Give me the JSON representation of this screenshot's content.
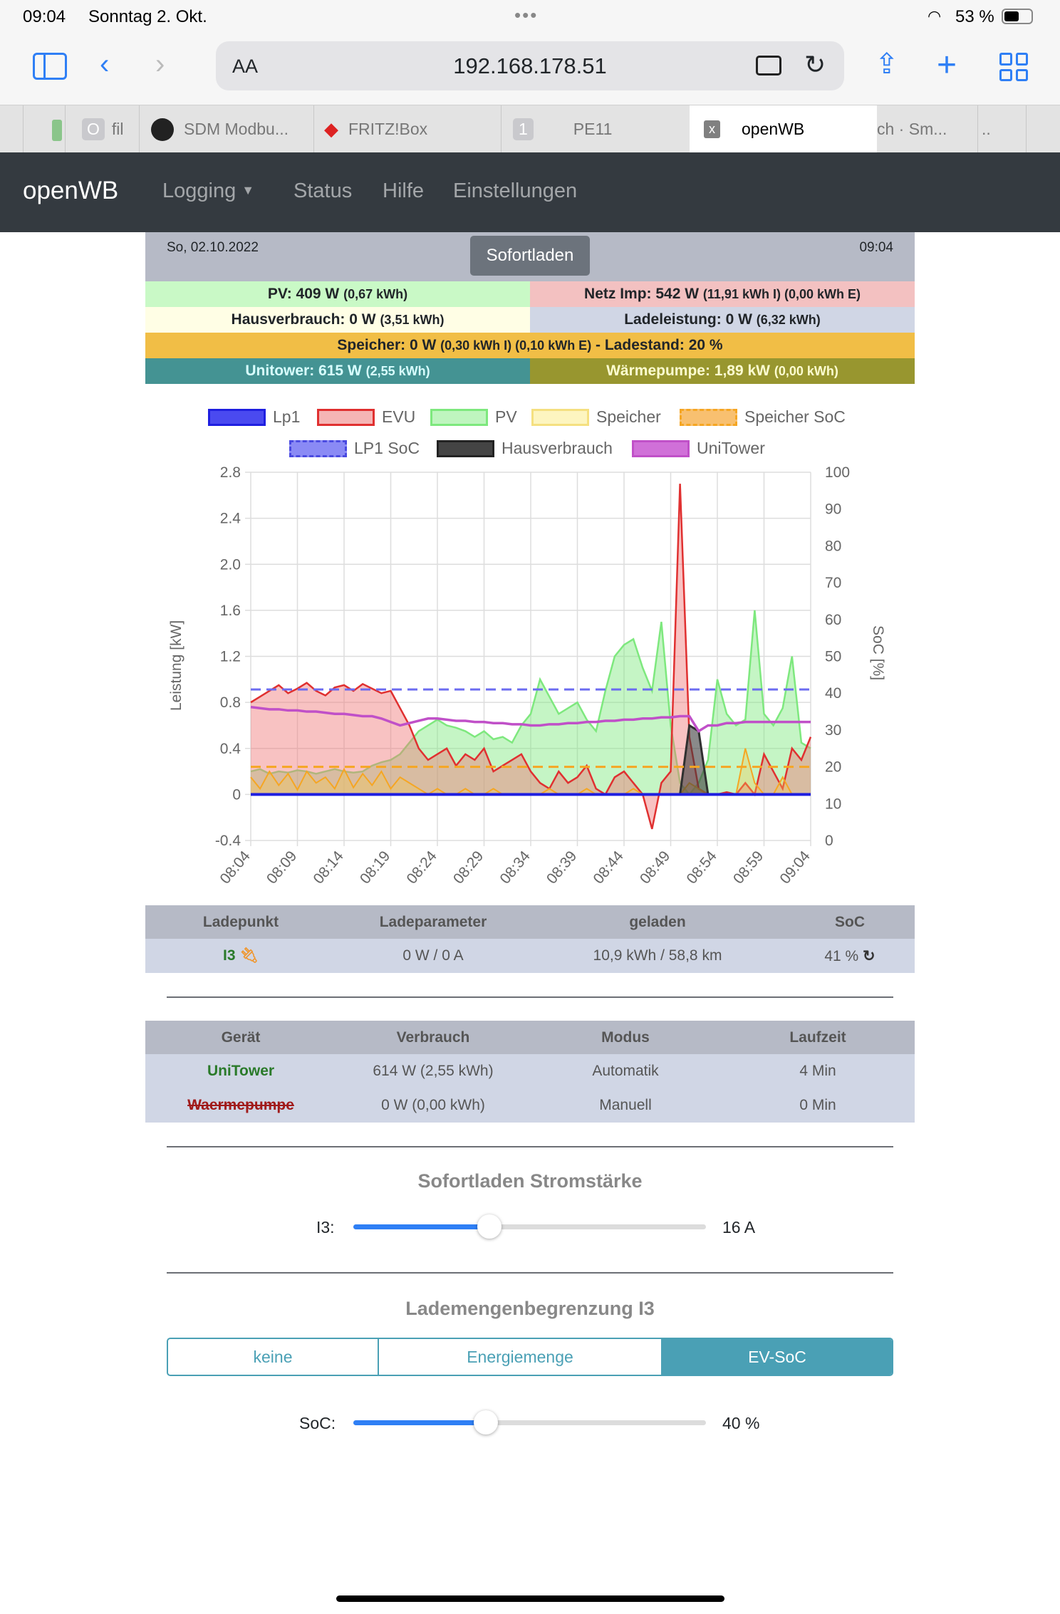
{
  "statusbar": {
    "time": "09:04",
    "date": "Sonntag 2. Okt.",
    "battery": "53 %"
  },
  "browser": {
    "aa_label": "AA",
    "url": "192.168.178.51",
    "tabs": [
      {
        "label": "fil"
      },
      {
        "label": "SDM Modbu..."
      },
      {
        "label": "FRITZ!Box"
      },
      {
        "label": "PE11",
        "badge": "1"
      },
      {
        "label": "openWB"
      },
      {
        "label": "ch · Sm..."
      },
      {
        "label": ".."
      }
    ]
  },
  "nav": {
    "brand": "openWB",
    "items": [
      "Logging",
      "Status",
      "Hilfe",
      "Einstellungen"
    ]
  },
  "header": {
    "date": "So, 02.10.2022",
    "mode_button": "Sofortladen",
    "time": "09:04"
  },
  "info": {
    "pv": {
      "main": "PV: 409 W",
      "sub": "(0,67 kWh)"
    },
    "netz": {
      "main": "Netz Imp: 542 W",
      "sub": "(11,91 kWh I) (0,00 kWh E)"
    },
    "haus": {
      "main": "Hausverbrauch: 0 W",
      "sub": "(3,51 kWh)"
    },
    "lade": {
      "main": "Ladeleistung: 0 W",
      "sub": "(6,32 kWh)"
    },
    "speicher": {
      "main1": "Speicher: 0 W",
      "sub": "(0,30 kWh I) (0,10 kWh E)",
      "main2": "- Ladestand: 20 %"
    },
    "unitower": {
      "main": "Unitower: 615 W",
      "sub": "(2,55 kWh)"
    },
    "waermepumpe": {
      "main": "Wärmepumpe: 1,89 kW",
      "sub": "(0,00 kWh)"
    }
  },
  "chart_data": {
    "type": "area",
    "xlabel": "",
    "ylabel": "Leistung [kW]",
    "y2label": "SoC [%]",
    "ylim": [
      -0.4,
      2.8
    ],
    "y2lim": [
      0,
      100
    ],
    "yticks": [
      "2.8",
      "2.4",
      "2.0",
      "1.6",
      "1.2",
      "0.8",
      "0.4",
      "0",
      "-0.4"
    ],
    "y2ticks": [
      "100",
      "90",
      "80",
      "70",
      "60",
      "50",
      "40",
      "30",
      "20",
      "10",
      "0"
    ],
    "xticks": [
      "08:04",
      "08:09",
      "08:14",
      "08:19",
      "08:24",
      "08:29",
      "08:34",
      "08:39",
      "08:44",
      "08:49",
      "08:54",
      "08:59",
      "09:04"
    ],
    "x_minutes_count": 61,
    "legend": [
      "Lp1",
      "EVU",
      "PV",
      "Speicher",
      "Speicher SoC",
      "LP1 SoC",
      "Hausverbrauch",
      "UniTower"
    ],
    "colors": {
      "Lp1": "#1f1fe0",
      "EVU": "#e03030",
      "PV": "#7ee87e",
      "Speicher": "#f5a623",
      "Speicher SoC": "#f5a623",
      "LP1 SoC": "#6b6bf0",
      "Hausverbrauch": "#303030",
      "UniTower": "#c050c8"
    },
    "series": {
      "Lp1": [
        0,
        0,
        0,
        0,
        0,
        0,
        0,
        0,
        0,
        0,
        0,
        0,
        0,
        0,
        0,
        0,
        0,
        0,
        0,
        0,
        0,
        0,
        0,
        0,
        0,
        0,
        0,
        0,
        0,
        0,
        0,
        0,
        0,
        0,
        0,
        0,
        0,
        0,
        0,
        0,
        0,
        0,
        0,
        0,
        0,
        0,
        0,
        0,
        0,
        0,
        0,
        0,
        0,
        0,
        0,
        0,
        0,
        0,
        0,
        0,
        0
      ],
      "EVU": [
        0.8,
        0.85,
        0.9,
        0.95,
        0.88,
        0.92,
        0.97,
        0.9,
        0.86,
        0.93,
        0.95,
        0.9,
        0.96,
        0.92,
        0.88,
        0.9,
        0.75,
        0.6,
        0.4,
        0.3,
        0.35,
        0.4,
        0.25,
        0.35,
        0.3,
        0.4,
        0.2,
        0.25,
        0.3,
        0.35,
        0.2,
        0.1,
        0.05,
        0.2,
        0.1,
        0.15,
        0.25,
        0.05,
        0.0,
        0.15,
        0.2,
        0.1,
        0.0,
        -0.3,
        0.1,
        0.2,
        2.7,
        0.5,
        0.05,
        0.0,
        0.0,
        0.02,
        0.0,
        0.1,
        0.0,
        0.35,
        0.2,
        0.05,
        0.4,
        0.3,
        0.5
      ],
      "PV": [
        0.2,
        0.22,
        0.18,
        0.2,
        0.19,
        0.21,
        0.2,
        0.18,
        0.2,
        0.22,
        0.2,
        0.19,
        0.2,
        0.25,
        0.28,
        0.3,
        0.35,
        0.45,
        0.55,
        0.6,
        0.65,
        0.6,
        0.58,
        0.55,
        0.5,
        0.55,
        0.48,
        0.5,
        0.45,
        0.6,
        0.7,
        1.0,
        0.85,
        0.7,
        0.75,
        0.8,
        0.65,
        0.55,
        0.9,
        1.2,
        1.3,
        1.35,
        1.1,
        0.9,
        1.5,
        0.6,
        0.1,
        0.0,
        0.1,
        0.3,
        1.0,
        0.7,
        0.6,
        0.65,
        1.6,
        0.7,
        0.6,
        0.75,
        1.2,
        0.45,
        0.4
      ],
      "Speicher": [
        0.15,
        0.05,
        0.2,
        0.08,
        0.18,
        0.04,
        0.2,
        0.1,
        0.15,
        0.05,
        0.22,
        0.06,
        0.18,
        0.08,
        0.2,
        0.05,
        0.15,
        0.1,
        0.05,
        0.0,
        0.05,
        0.0,
        0.0,
        0.05,
        0.0,
        0.0,
        0.05,
        0.0,
        0.0,
        0.0,
        0.0,
        0.0,
        0.05,
        0.0,
        0.0,
        0.0,
        0.05,
        0.0,
        0.0,
        0.0,
        0.0,
        0.05,
        0.0,
        0.0,
        0.0,
        0.0,
        0.0,
        0.1,
        0.05,
        0.0,
        0.0,
        0.0,
        0.0,
        0.4,
        0.1,
        0.0,
        0.0,
        0.15,
        0.0,
        0.0,
        0.0
      ],
      "Hausverbrauch": [
        0,
        0,
        0,
        0,
        0,
        0,
        0,
        0,
        0,
        0,
        0,
        0,
        0,
        0,
        0,
        0,
        0,
        0,
        0,
        0,
        0,
        0,
        0,
        0,
        0,
        0,
        0,
        0,
        0,
        0,
        0,
        0,
        0,
        0,
        0,
        0,
        0,
        0,
        0,
        0,
        0,
        0,
        0,
        0,
        0,
        0,
        0,
        0.6,
        0.55,
        0,
        0,
        0,
        0,
        0,
        0,
        0,
        0,
        0,
        0,
        0,
        0
      ],
      "UniTower": [
        0.76,
        0.75,
        0.74,
        0.74,
        0.73,
        0.73,
        0.72,
        0.72,
        0.71,
        0.7,
        0.7,
        0.69,
        0.68,
        0.68,
        0.66,
        0.63,
        0.6,
        0.62,
        0.64,
        0.66,
        0.66,
        0.65,
        0.64,
        0.64,
        0.63,
        0.63,
        0.62,
        0.62,
        0.61,
        0.61,
        0.6,
        0.6,
        0.61,
        0.61,
        0.62,
        0.62,
        0.63,
        0.63,
        0.64,
        0.64,
        0.65,
        0.65,
        0.66,
        0.66,
        0.67,
        0.67,
        0.68,
        0.68,
        0.55,
        0.6,
        0.6,
        0.62,
        0.62,
        0.63,
        0.63,
        0.63,
        0.63,
        0.63,
        0.63,
        0.63,
        0.63
      ],
      "LP1 SoC": 41,
      "Speicher SoC": 20
    }
  },
  "ladepunkt_table": {
    "headers": [
      "Ladepunkt",
      "Ladeparameter",
      "geladen",
      "SoC"
    ],
    "rows": [
      {
        "name": "I3",
        "param": "0 W / 0 A",
        "geladen": "10,9 kWh / 58,8 km",
        "soc": "41 %"
      }
    ]
  },
  "device_table": {
    "headers": [
      "Gerät",
      "Verbrauch",
      "Modus",
      "Laufzeit"
    ],
    "rows": [
      {
        "name": "UniTower",
        "verbrauch": "614 W (2,55 kWh)",
        "modus": "Automatik",
        "laufzeit": "4 Min"
      },
      {
        "name": "Waermepumpe",
        "verbrauch": "0 W (0,00 kWh)",
        "modus": "Manuell",
        "laufzeit": "0 Min"
      }
    ]
  },
  "sofortladen": {
    "title": "Sofortladen Stromstärke",
    "label": "I3:",
    "value": "16 A",
    "fill_fraction": 0.385
  },
  "lademengen": {
    "title": "Lademengenbegrenzung I3",
    "options": [
      "keine",
      "Energiemenge",
      "EV-SoC"
    ],
    "active": "EV-SoC",
    "soc_label": "SoC:",
    "soc_value": "40 %",
    "fill_fraction": 0.375
  }
}
